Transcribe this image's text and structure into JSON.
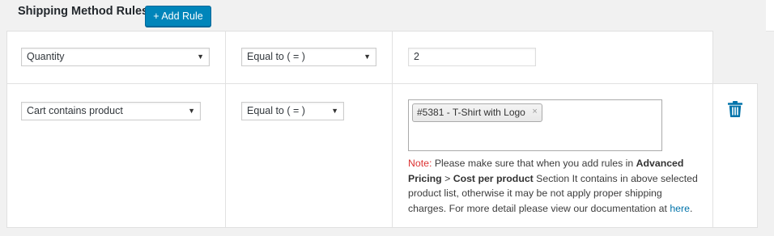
{
  "header": {
    "title": "Shipping Method Rules",
    "add_rule_label": "+ Add Rule"
  },
  "rules": [
    {
      "condition": "Quantity",
      "operator": "Equal to ( = )",
      "value": "2"
    },
    {
      "condition": "Cart contains product",
      "operator": "Equal to ( = )",
      "selected_product": "#5381 - T-Shirt with Logo",
      "remove_symbol": "×",
      "note": {
        "label": "Note:",
        "text_1": " Please make sure that when you add rules in ",
        "bold_1": "Advanced Pricing",
        "text_2": " > ",
        "bold_2": "Cost per product",
        "text_3": " Section It contains in above selected product list, otherwise it may be not apply proper shipping charges. For more detail please view our documentation at ",
        "link": "here",
        "text_4": "."
      }
    }
  ],
  "icons": {
    "dropdown": "chevron-down-icon",
    "delete": "trash-icon"
  },
  "colors": {
    "primary": "#0085ba",
    "trash": "#0073aa",
    "note_label": "#dc3232",
    "link": "#0073aa"
  }
}
